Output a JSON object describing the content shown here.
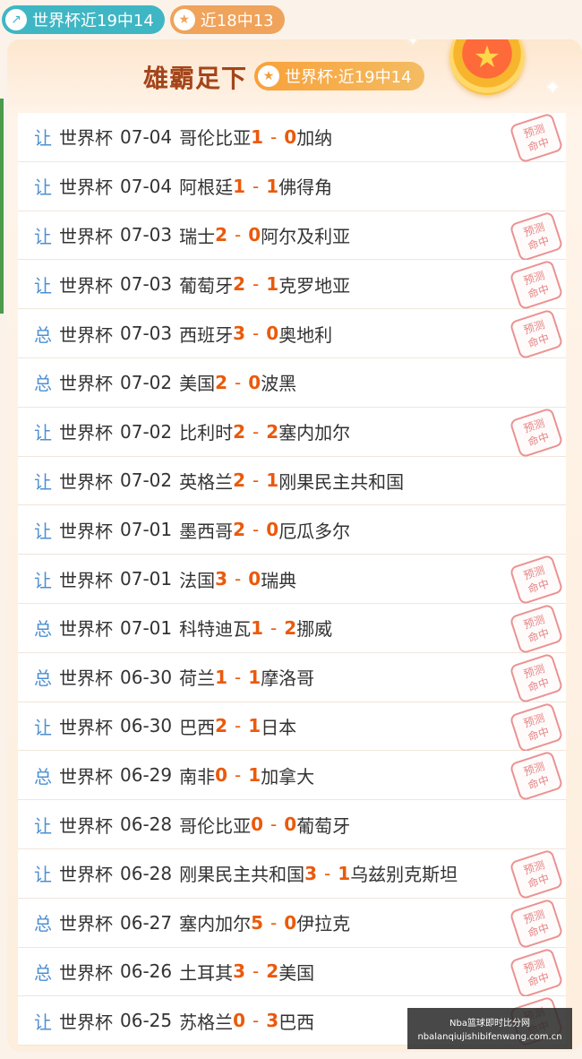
{
  "top_tabs": [
    {
      "label": "世界杯近19中14",
      "icon": "arrow-up-icon"
    },
    {
      "label": "近18中13",
      "icon": "star-icon"
    }
  ],
  "header": {
    "title": "雄霸足下",
    "badge": "世界杯·近19中14"
  },
  "stamp_text": {
    "line1": "预测",
    "line2": "命中"
  },
  "rows": [
    {
      "kind": "让",
      "comp": "世界杯",
      "date": "07-04",
      "home": "哥伦比亚",
      "hs": "1",
      "as": "0",
      "away": "加纳",
      "hit": true
    },
    {
      "kind": "让",
      "comp": "世界杯",
      "date": "07-04",
      "home": "阿根廷",
      "hs": "1",
      "as": "1",
      "away": "佛得角",
      "hit": false
    },
    {
      "kind": "让",
      "comp": "世界杯",
      "date": "07-03",
      "home": "瑞士",
      "hs": "2",
      "as": "0",
      "away": "阿尔及利亚",
      "hit": true
    },
    {
      "kind": "让",
      "comp": "世界杯",
      "date": "07-03",
      "home": "葡萄牙",
      "hs": "2",
      "as": "1",
      "away": "克罗地亚",
      "hit": true
    },
    {
      "kind": "总",
      "comp": "世界杯",
      "date": "07-03",
      "home": "西班牙",
      "hs": "3",
      "as": "0",
      "away": "奥地利",
      "hit": true
    },
    {
      "kind": "总",
      "comp": "世界杯",
      "date": "07-02",
      "home": "美国",
      "hs": "2",
      "as": "0",
      "away": "波黑",
      "hit": false
    },
    {
      "kind": "让",
      "comp": "世界杯",
      "date": "07-02",
      "home": "比利时",
      "hs": "2",
      "as": "2",
      "away": "塞内加尔",
      "hit": true
    },
    {
      "kind": "让",
      "comp": "世界杯",
      "date": "07-02",
      "home": "英格兰",
      "hs": "2",
      "as": "1",
      "away": "刚果民主共和国",
      "hit": false
    },
    {
      "kind": "让",
      "comp": "世界杯",
      "date": "07-01",
      "home": "墨西哥",
      "hs": "2",
      "as": "0",
      "away": "厄瓜多尔",
      "hit": false
    },
    {
      "kind": "让",
      "comp": "世界杯",
      "date": "07-01",
      "home": "法国",
      "hs": "3",
      "as": "0",
      "away": "瑞典",
      "hit": true
    },
    {
      "kind": "总",
      "comp": "世界杯",
      "date": "07-01",
      "home": "科特迪瓦",
      "hs": "1",
      "as": "2",
      "away": "挪威",
      "hit": true
    },
    {
      "kind": "总",
      "comp": "世界杯",
      "date": "06-30",
      "home": "荷兰",
      "hs": "1",
      "as": "1",
      "away": "摩洛哥",
      "hit": true
    },
    {
      "kind": "让",
      "comp": "世界杯",
      "date": "06-30",
      "home": "巴西",
      "hs": "2",
      "as": "1",
      "away": "日本",
      "hit": true
    },
    {
      "kind": "总",
      "comp": "世界杯",
      "date": "06-29",
      "home": "南非",
      "hs": "0",
      "as": "1",
      "away": "加拿大",
      "hit": true
    },
    {
      "kind": "让",
      "comp": "世界杯",
      "date": "06-28",
      "home": "哥伦比亚",
      "hs": "0",
      "as": "0",
      "away": "葡萄牙",
      "hit": false
    },
    {
      "kind": "让",
      "comp": "世界杯",
      "date": "06-28",
      "home": "刚果民主共和国",
      "hs": "3",
      "as": "1",
      "away": "乌兹别克斯坦",
      "hit": true
    },
    {
      "kind": "总",
      "comp": "世界杯",
      "date": "06-27",
      "home": "塞内加尔",
      "hs": "5",
      "as": "0",
      "away": "伊拉克",
      "hit": true
    },
    {
      "kind": "总",
      "comp": "世界杯",
      "date": "06-26",
      "home": "土耳其",
      "hs": "3",
      "as": "2",
      "away": "美国",
      "hit": true
    },
    {
      "kind": "让",
      "comp": "世界杯",
      "date": "06-25",
      "home": "苏格兰",
      "hs": "0",
      "as": "3",
      "away": "巴西",
      "hit": true
    }
  ],
  "watermark": {
    "line1": "Nba篮球即时比分网",
    "line2": "nbalanqiujishibifenwang.com.cn"
  },
  "colors": {
    "score": "#ea5a0c",
    "kind": "#4e8fd1",
    "title": "#a4441a"
  }
}
